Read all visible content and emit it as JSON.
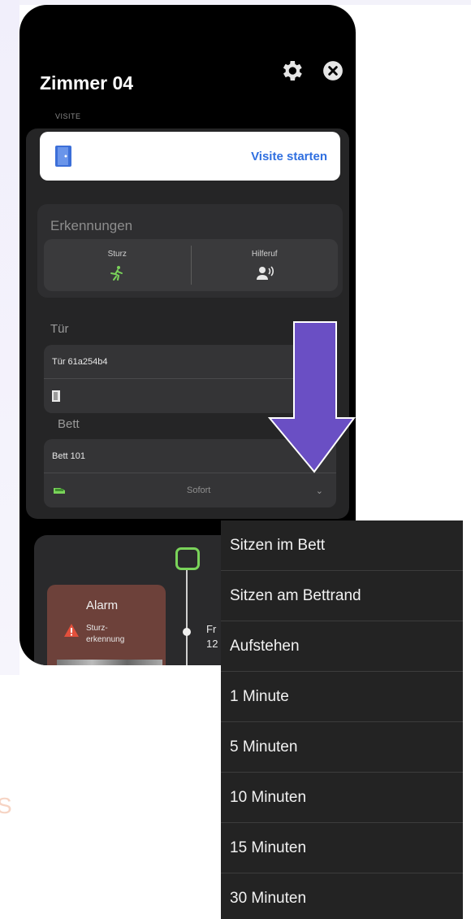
{
  "header": {
    "room_title": "Zimmer 04",
    "section_caption": "VISITE"
  },
  "visite": {
    "start_label": "Visite starten"
  },
  "erkennungen": {
    "title": "Erkennungen",
    "items": [
      {
        "label": "Sturz",
        "icon": "fall-icon"
      },
      {
        "label": "Hilferuf",
        "icon": "help-call-icon"
      }
    ]
  },
  "tur": {
    "label": "Tür",
    "device_name": "Tür 61a254b4",
    "icon": "door-icon"
  },
  "bett": {
    "label": "Bett",
    "device_name": "Bett 101",
    "icon": "bed-icon",
    "selected": "Sofort"
  },
  "alarm": {
    "title": "Alarm",
    "desc_line1": "Sturz-",
    "desc_line2": "erkennung"
  },
  "timeline": {
    "cut_line1": "Fr",
    "cut_line2": "12"
  },
  "dropdown": {
    "options": [
      "Sitzen im Bett",
      "Sitzen am Bettrand",
      "Aufstehen",
      "1 Minute",
      "5 Minuten",
      "10 Minuten",
      "15 Minuten",
      "30 Minuten"
    ]
  },
  "colors": {
    "accent_link": "#2f6fe0",
    "arrow": "#6a4fc4",
    "alarm_bg": "#6d413a",
    "green": "#7ad35a"
  },
  "background_fragment": "S"
}
